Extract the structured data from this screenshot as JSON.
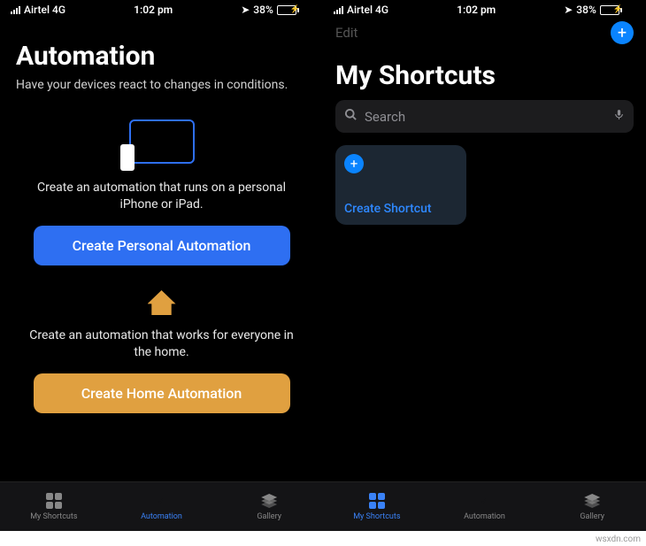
{
  "status": {
    "carrier": "Airtel 4G",
    "time": "1:02 pm",
    "battery_percent": "38%"
  },
  "left": {
    "title": "Automation",
    "subtitle": "Have your devices react to changes in conditions.",
    "personal": {
      "text": "Create an automation that runs on a personal iPhone or iPad.",
      "button": "Create Personal Automation"
    },
    "home": {
      "text": "Create an automation that works for everyone in the home.",
      "button": "Create Home Automation"
    },
    "tabs": {
      "shortcuts": "My Shortcuts",
      "automation": "Automation",
      "gallery": "Gallery"
    }
  },
  "right": {
    "edit": "Edit",
    "title": "My Shortcuts",
    "search_placeholder": "Search",
    "card_label": "Create Shortcut",
    "tabs": {
      "shortcuts": "My Shortcuts",
      "automation": "Automation",
      "gallery": "Gallery"
    }
  },
  "watermark": "wsxdn.com"
}
